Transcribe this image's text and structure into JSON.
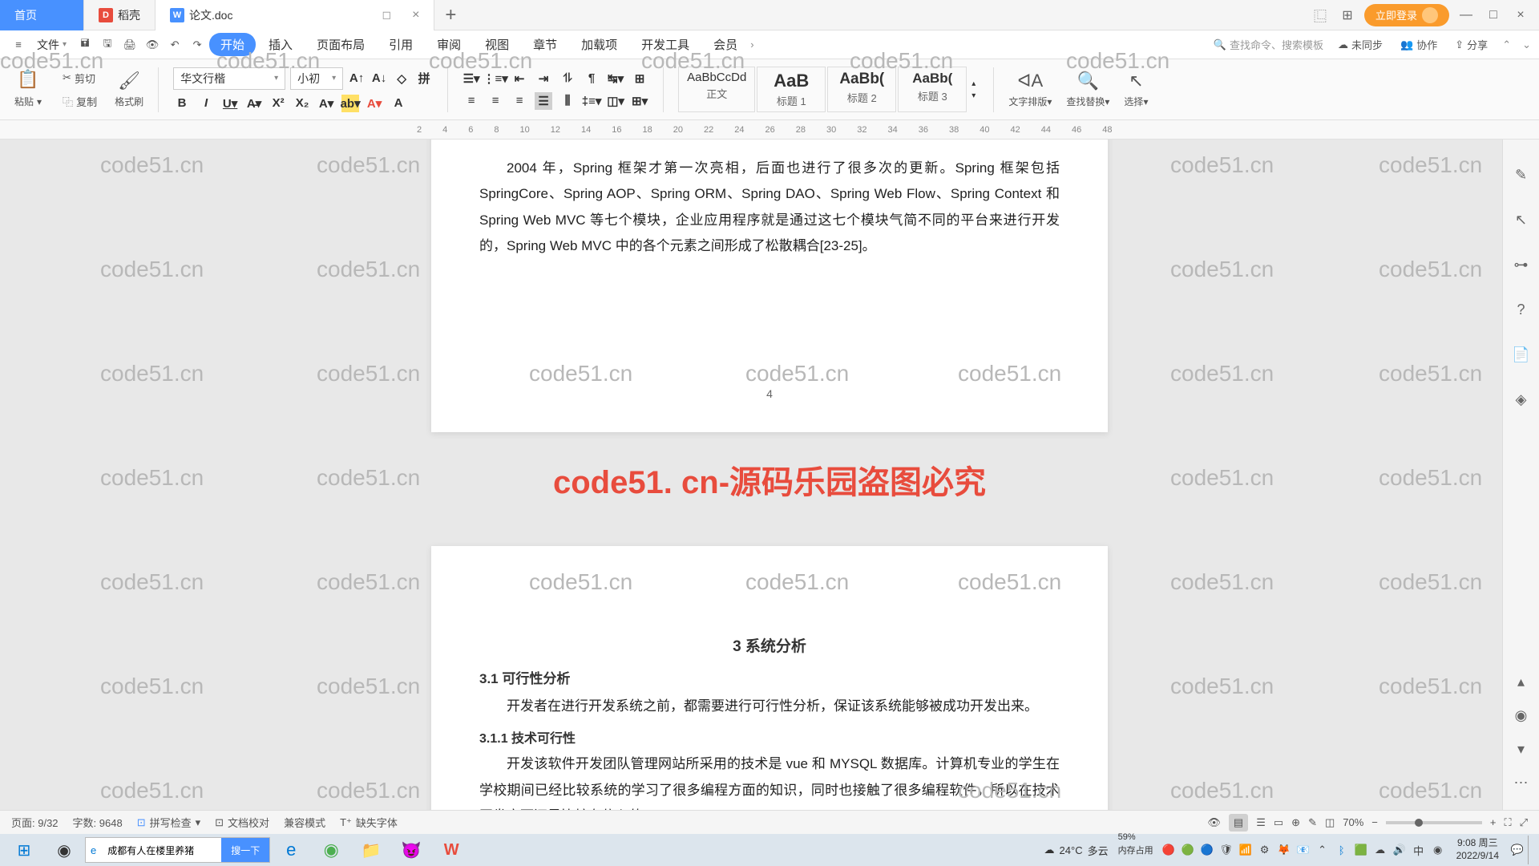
{
  "titlebar": {
    "home_tab": "首页",
    "daoke_tab": "稻壳",
    "doc_tab": "论文.doc",
    "login_btn": "立即登录"
  },
  "menubar": {
    "file": "文件",
    "items": [
      "开始",
      "插入",
      "页面布局",
      "引用",
      "审阅",
      "视图",
      "章节",
      "加载项",
      "开发工具",
      "会员"
    ],
    "search_placeholder": "查找命令、搜索模板",
    "unsynced": "未同步",
    "collab": "协作",
    "share": "分享"
  },
  "ribbon": {
    "paste": "粘贴",
    "cut": "剪切",
    "copy": "复制",
    "format_painter": "格式刷",
    "font_name": "华文行楷",
    "font_size": "小初",
    "styles": [
      {
        "preview": "AaBbCcDd",
        "name": "正文"
      },
      {
        "preview": "AaB",
        "name": "标题 1"
      },
      {
        "preview": "AaBb(",
        "name": "标题 2"
      },
      {
        "preview": "AaBb(",
        "name": "标题 3"
      }
    ],
    "text_layout": "文字排版",
    "find_replace": "查找替换",
    "select": "选择"
  },
  "ruler": [
    "2",
    "4",
    "6",
    "8",
    "10",
    "12",
    "14",
    "16",
    "18",
    "20",
    "22",
    "24",
    "26",
    "28",
    "30",
    "32",
    "34",
    "36",
    "38",
    "40",
    "42",
    "44",
    "46",
    "48"
  ],
  "document": {
    "para1": "2004 年，Spring 框架才第一次亮相，后面也进行了很多次的更新。Spring 框架包括 SpringCore、Spring AOP、Spring ORM、Spring DAO、Spring Web Flow、Spring Context 和 Spring Web MVC 等七个模块，企业应用程序就是通过这七个模块气简不同的平台来进行开发的，Spring Web MVC 中的各个元素之间形成了松散耦合[23-25]。",
    "page_num1": "4",
    "red_banner": "code51. cn-源码乐园盗图必究",
    "h3": "3  系统分析",
    "h4_1": "3.1  可行性分析",
    "para2": "开发者在进行开发系统之前，都需要进行可行性分析，保证该系统能够被成功开发出来。",
    "h5_1": "3.1.1  技术可行性",
    "para3": "开发该软件开发团队管理网站所采用的技术是 vue 和 MYSQL 数据库。计算机专业的学生在学校期间已经比较系统的学习了很多编程方面的知识，同时也接触了很多编程软件，所以在技术开发方面还是比较有信心的。"
  },
  "statusbar": {
    "page": "页面: 9/32",
    "words": "字数: 9648",
    "spell": "拼写检查",
    "compare": "文档校对",
    "compat": "兼容模式",
    "missing_font": "缺失字体",
    "zoom": "70%",
    "percent_label": "59%",
    "memory": "内存占用"
  },
  "taskbar": {
    "search_text": "成都有人在楼里养猪",
    "search_btn": "搜一下",
    "weather_temp": "24°C",
    "weather_desc": "多云",
    "time": "9:08 周三",
    "date": "2022/9/14"
  },
  "watermarks": [
    "code51.cn"
  ]
}
